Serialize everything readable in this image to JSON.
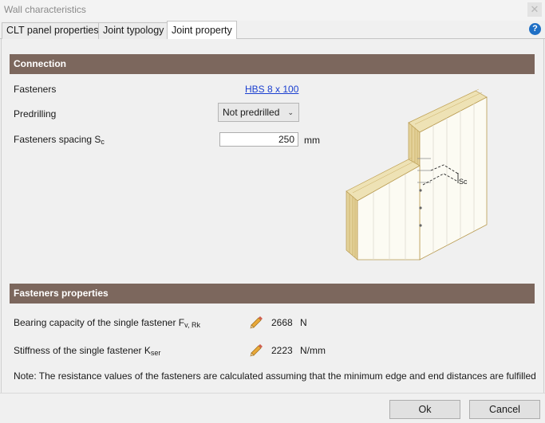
{
  "window": {
    "title": "Wall characteristics",
    "close_glyph": "✕"
  },
  "tabs": [
    {
      "label": "CLT panel properties",
      "active": false
    },
    {
      "label": "Joint typology",
      "active": false
    },
    {
      "label": "Joint property",
      "active": true
    }
  ],
  "help_icon": "?",
  "connection": {
    "header": "Connection",
    "fasteners_label": "Fasteners",
    "fasteners_link": "HBS 8 x 100",
    "predrilling_label": "Predrilling",
    "predrilling_value": "Not predrilled",
    "spacing_label": "Fasteners spacing S",
    "spacing_sub": "c",
    "spacing_value": "250",
    "spacing_unit": "mm",
    "diagram_label": "Sc"
  },
  "fastener_properties": {
    "header": "Fasteners properties",
    "bearing_label": "Bearing capacity of the single fastener F",
    "bearing_sub": "v, Rk",
    "bearing_value": "2668",
    "bearing_unit": "N",
    "stiffness_label": "Stiffness of the single fastener K",
    "stiffness_sub": "ser",
    "stiffness_value": "2223",
    "stiffness_unit": "N/mm",
    "note": "Note: The resistance values of the fasteners are calculated assuming that the minimum edge and end distances are fulfilled"
  },
  "buttons": {
    "ok": "Ok",
    "cancel": "Cancel"
  },
  "colors": {
    "section_header": "#7c675d",
    "link": "#1a3fd0",
    "help": "#1f6fc5",
    "pencil": "#e8a838"
  },
  "icons": {
    "edit": "pencil-icon",
    "help": "help-icon",
    "dropdown": "chevron-down-icon"
  }
}
